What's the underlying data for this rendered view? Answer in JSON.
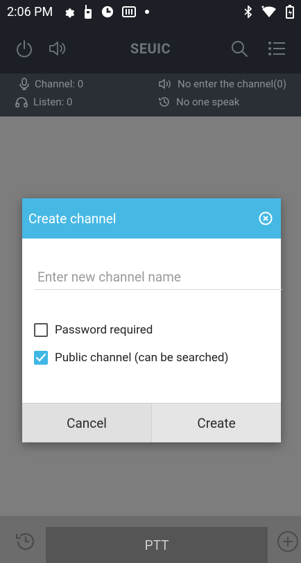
{
  "status_bar": {
    "time": "2:06 PM"
  },
  "app_bar": {
    "title": "SEUIC"
  },
  "info": {
    "channel": "Channel: 0",
    "listen": "Listen: 0",
    "enter_status": "No enter the channel(0)",
    "speak_status": "No one speak"
  },
  "dialog": {
    "title": "Create channel",
    "placeholder": "Enter new channel name",
    "value": "",
    "password_label": "Password required",
    "password_checked": false,
    "public_label": "Public channel (can be searched)",
    "public_checked": true,
    "cancel_label": "Cancel",
    "create_label": "Create"
  },
  "bottom": {
    "ptt_label": "PTT"
  },
  "colors": {
    "accent": "#46b8e4",
    "bar": "#1c1f25",
    "info_bar": "#2a2e35",
    "scrim": "#7d7d7d"
  }
}
